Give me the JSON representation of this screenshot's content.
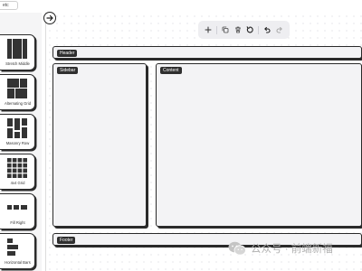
{
  "top_chip": "etc",
  "palette": {
    "items": [
      {
        "label": "Stretch Middle",
        "icon": "stretch-middle-layout-icon"
      },
      {
        "label": "Alternating Grid",
        "icon": "alternating-grid-layout-icon"
      },
      {
        "label": "Masonry Row",
        "icon": "masonry-row-layout-icon"
      },
      {
        "label": "4x4 Grid",
        "icon": "grid-4x4-layout-icon"
      },
      {
        "label": "Fill Right",
        "icon": "fill-right-layout-icon"
      },
      {
        "label": "Horizontal Bars",
        "icon": "horizontal-bars-layout-icon"
      }
    ]
  },
  "toolbar": {
    "buttons": [
      "add-icon",
      "duplicate-icon",
      "delete-icon",
      "reset-icon",
      "undo-icon",
      "redo-icon"
    ]
  },
  "canvas": {
    "header_label": "Header",
    "sidebar_label": "Sidebar",
    "content_label": "Content",
    "footer_label": "Footer"
  },
  "watermark": {
    "text": "公众号 · 前端新福"
  },
  "colors": {
    "stroke": "#2a2a2a",
    "block_fill": "#f3f3f5",
    "label_fill": "#2f2f2f",
    "toolbar_bg": "#eeeef1",
    "palette_bg": "#f5f5f6"
  }
}
